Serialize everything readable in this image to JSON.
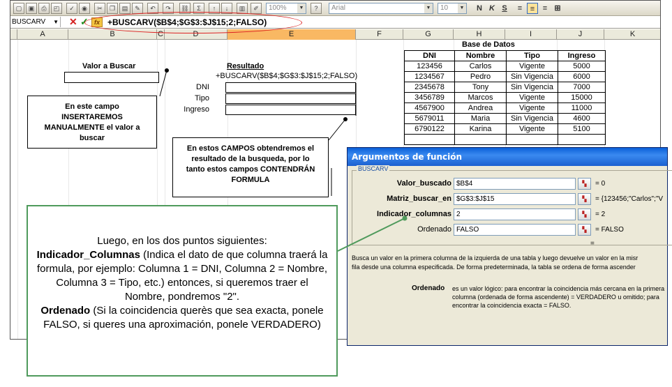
{
  "toolbar": {
    "zoom": "100%",
    "font": "Arial",
    "font_size": "10",
    "fmt_bold": "N",
    "fmt_italic": "K",
    "fmt_underline": "S",
    "icons": [
      "new-icon",
      "save-icon",
      "print-icon",
      "preview-icon",
      "spell-icon",
      "cut-icon",
      "copy-icon",
      "paste-icon",
      "undo-icon",
      "redo-icon",
      "hyperlink-icon",
      "autosum-icon",
      "sort-asc-icon",
      "sort-desc-icon",
      "chart-icon",
      "drawing-icon",
      "help-icon"
    ]
  },
  "formula_bar": {
    "name_box": "BUSCARV",
    "formula": "+BUSCARV($B$4;$G$3:$J$15;2;FALSO)"
  },
  "columns": [
    "A",
    "B",
    "C",
    "D",
    "E",
    "F",
    "G",
    "H",
    "I",
    "J",
    "K"
  ],
  "sheet": {
    "valor_buscar_label": "Valor a Buscar",
    "resultado_label": "Resultado",
    "resultado_formula": "+BUSCARV($B$4;$G$3:$J$15;2;FALSO)",
    "fields": [
      "DNI",
      "Tipo",
      "Ingreso"
    ],
    "callout_left": [
      "En este campo",
      "INSERTAREMOS",
      "MANUALMENTE el valor a",
      "buscar"
    ],
    "callout_mid": [
      "En estos CAMPOS obtendremos el",
      "resultado de la busqueda, por lo",
      "tanto estos campos CONTENDRÁN",
      "FORMULA"
    ]
  },
  "database": {
    "title": "Base de Datos",
    "headers": [
      "DNI",
      "Nombre",
      "Tipo",
      "Ingreso"
    ],
    "rows": [
      [
        "123456",
        "Carlos",
        "Vigente",
        "5000"
      ],
      [
        "1234567",
        "Pedro",
        "Sin Vigencia",
        "6000"
      ],
      [
        "2345678",
        "Tony",
        "Sin Vigencia",
        "7000"
      ],
      [
        "3456789",
        "Marcos",
        "Vigente",
        "15000"
      ],
      [
        "4567900",
        "Andrea",
        "Vigente",
        "11000"
      ],
      [
        "5679011",
        "Maria",
        "Sin Vigencia",
        "4600"
      ],
      [
        "6790122",
        "Karina",
        "Vigente",
        "5100"
      ],
      [
        "",
        "",
        "",
        ""
      ]
    ]
  },
  "dialog": {
    "title": "Argumentos de función",
    "function": "BUSCARV",
    "args": [
      {
        "label": "Valor_buscado",
        "value": "$B$4",
        "result": "= 0"
      },
      {
        "label": "Matriz_buscar_en",
        "value": "$G$3:$J$15",
        "result": "= {123456;\"Carlos\";\"V"
      },
      {
        "label": "Indicador_columnas",
        "value": "2",
        "result": "= 2"
      },
      {
        "label": "Ordenado",
        "value": "FALSO",
        "result": "= FALSO"
      }
    ],
    "equals": "=",
    "description_1": "Busca un valor en la primera columna de la izquierda de una tabla y luego devuelve un valor en la misr",
    "description_2": "fila desde una columna especificada. De forma predeterminada, la tabla se ordena de forma ascender",
    "param_name": "Ordenado",
    "param_desc": "es un valor lógico: para encontrar la coincidencia más cercana en la primera columna (ordenada de forma ascendente) = VERDADERO u omitido; para encontrar la coincidencia exacta = FALSO."
  },
  "note": {
    "line1": "Luego, en los dos puntos siguientes:",
    "term1": "Indicador_Columnas",
    "text1": " (Indica el dato de que columna traerá la formula, por ejemplo: Columna 1 = DNI, Columna 2 = Nombre, Columna 3 = Tipo, etc.) entonces, si queremos traer el Nombre, pondremos \"2\".",
    "term2": "Ordenado",
    "text2": " (Si la coincidencia querès que sea exacta, ponele FALSO, si queres una aproximación, ponele VERDADERO)"
  },
  "colors": {
    "ellipse": "#dd2222",
    "note_border": "#4f9a5c",
    "dialog_title": "#0a5fd8",
    "selected_col": "#f9b863"
  }
}
